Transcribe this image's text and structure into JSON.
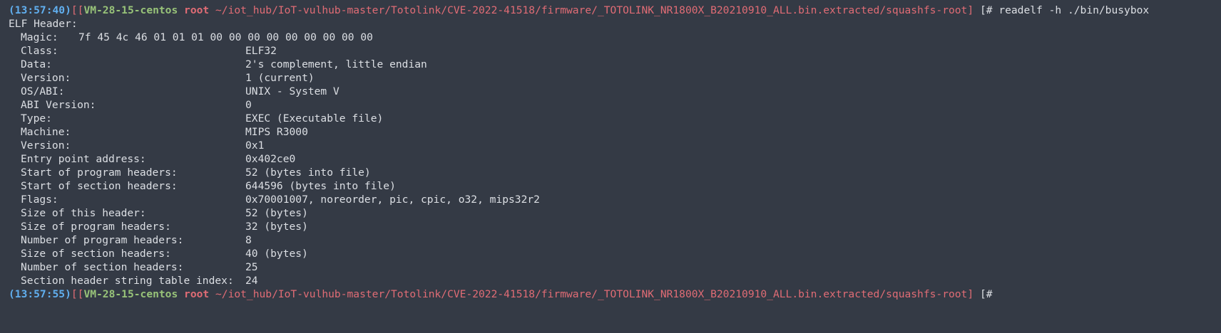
{
  "colors": {
    "background": "#343a45",
    "foreground": "#dcdfe4",
    "timestamp": "#61afef",
    "host": "#98c379",
    "user_path": "#e06c75"
  },
  "prompt1": {
    "timestamp": "(13:57:40)",
    "open": "[[",
    "host": "VM-28-15-centos",
    "user": "root",
    "path": "~/iot_hub/IoT-vulhub-master/Totolink/CVE-2022-41518/firmware/_TOTOLINK_NR1800X_B20210910_ALL.bin.extracted/squashfs-root",
    "close": "]",
    "hash": "[#",
    "command": "readelf -h ./bin/busybox"
  },
  "header_title": "ELF Header:",
  "magic": {
    "key": "Magic:",
    "value": "7f 45 4c 46 01 01 01 00 00 00 00 00 00 00 00 00"
  },
  "fields": [
    {
      "key": "Class:",
      "value": "ELF32"
    },
    {
      "key": "Data:",
      "value": "2's complement, little endian"
    },
    {
      "key": "Version:",
      "value": "1 (current)"
    },
    {
      "key": "OS/ABI:",
      "value": "UNIX - System V"
    },
    {
      "key": "ABI Version:",
      "value": "0"
    },
    {
      "key": "Type:",
      "value": "EXEC (Executable file)"
    },
    {
      "key": "Machine:",
      "value": "MIPS R3000"
    },
    {
      "key": "Version:",
      "value": "0x1"
    },
    {
      "key": "Entry point address:",
      "value": "0x402ce0"
    },
    {
      "key": "Start of program headers:",
      "value": "52 (bytes into file)"
    },
    {
      "key": "Start of section headers:",
      "value": "644596 (bytes into file)"
    },
    {
      "key": "Flags:",
      "value": "0x70001007, noreorder, pic, cpic, o32, mips32r2"
    },
    {
      "key": "Size of this header:",
      "value": "52 (bytes)"
    },
    {
      "key": "Size of program headers:",
      "value": "32 (bytes)"
    },
    {
      "key": "Number of program headers:",
      "value": "8"
    },
    {
      "key": "Size of section headers:",
      "value": "40 (bytes)"
    },
    {
      "key": "Number of section headers:",
      "value": "25"
    },
    {
      "key": "Section header string table index:",
      "value": "24"
    }
  ],
  "prompt2": {
    "timestamp": "(13:57:55)",
    "open": "[[",
    "host": "VM-28-15-centos",
    "user": "root",
    "path": "~/iot_hub/IoT-vulhub-master/Totolink/CVE-2022-41518/firmware/_TOTOLINK_NR1800X_B20210910_ALL.bin.extracted/squashfs-root",
    "close": "]",
    "hash": "[#"
  }
}
